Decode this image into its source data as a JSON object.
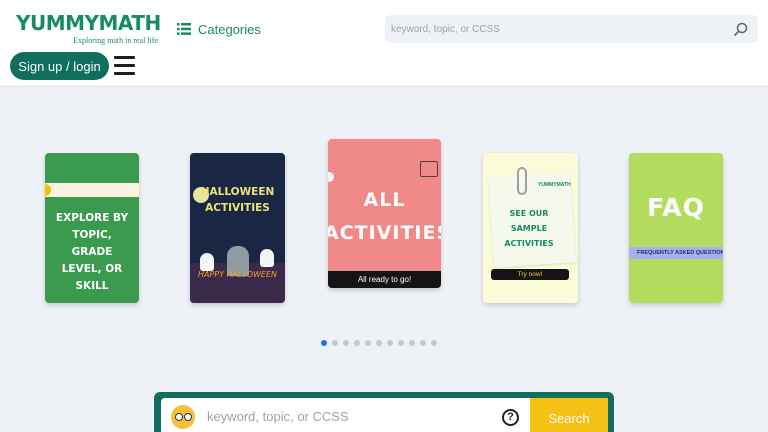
{
  "header": {
    "logo_title": "YUMMYMATH",
    "logo_tagline": "Exploring math in real life",
    "categories_label": "Categories",
    "search_placeholder": "keyword, topic, or CCSS",
    "signup_label": "Sign up / login"
  },
  "carousel": {
    "cards": [
      {
        "name": "explore",
        "text": "EXPLORE BY TOPIC, GRADE LEVEL, OR SKILL",
        "color": "#3a9b4f"
      },
      {
        "name": "halloween",
        "text": "HALLOWEEN ACTIVITIES",
        "subtext": "HAPPY HALLOWEEN",
        "color": "#1a2744"
      },
      {
        "name": "all-activities",
        "text": "ALL ACTIVITIES",
        "subtext": "All ready to go!",
        "color": "#ef8a89"
      },
      {
        "name": "sample",
        "brand": "YUMMYMATH",
        "text": "SEE OUR SAMPLE ACTIVITIES",
        "subtext": "Try now!",
        "color": "#fbfbd8"
      },
      {
        "name": "faq",
        "text": "FAQ",
        "subtext": "FREQUENTLY ASKED QUESTIONS",
        "color": "#b4dd5f"
      }
    ],
    "dots_total": 11,
    "active_dot": 1
  },
  "main_search": {
    "placeholder": "keyword, topic, or CCSS",
    "help_label": "?",
    "button_label": "Search"
  },
  "colors": {
    "brand_green": "#178a67",
    "dark_green": "#0f6e5c",
    "search_yellow": "#f5c115",
    "active_dot": "#1e74e0"
  },
  "icons": {
    "categories": "list-icon",
    "search": "search-icon",
    "menu": "hamburger-icon",
    "avatar": "owl-icon",
    "help": "help-icon"
  }
}
